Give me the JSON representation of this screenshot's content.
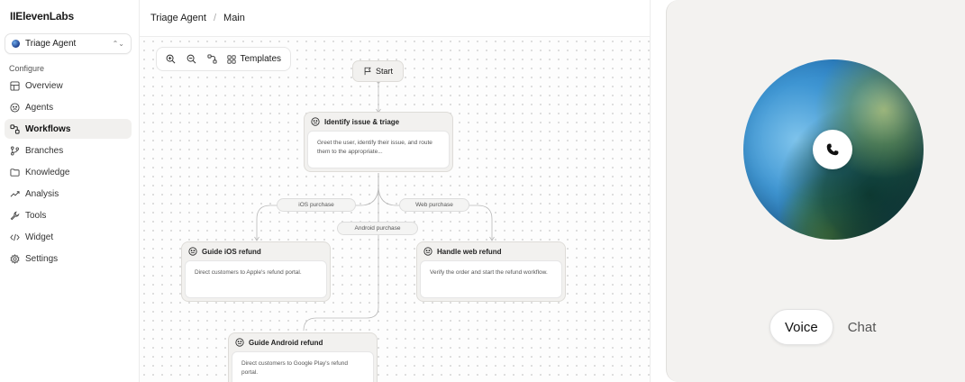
{
  "brand": "IIElevenLabs",
  "agent_selector": {
    "name": "Triage Agent"
  },
  "sidebar": {
    "section_label": "Configure",
    "items": [
      {
        "label": "Overview",
        "icon": "overview-icon",
        "active": false
      },
      {
        "label": "Agents",
        "icon": "agents-icon",
        "active": false
      },
      {
        "label": "Workflows",
        "icon": "workflows-icon",
        "active": true
      },
      {
        "label": "Branches",
        "icon": "branches-icon",
        "active": false
      },
      {
        "label": "Knowledge",
        "icon": "knowledge-icon",
        "active": false
      },
      {
        "label": "Analysis",
        "icon": "analysis-icon",
        "active": false
      },
      {
        "label": "Tools",
        "icon": "tools-icon",
        "active": false
      },
      {
        "label": "Widget",
        "icon": "widget-icon",
        "active": false
      },
      {
        "label": "Settings",
        "icon": "settings-icon",
        "active": false
      }
    ]
  },
  "breadcrumb": {
    "agent": "Triage Agent",
    "separator": "/",
    "branch": "Main"
  },
  "toolbar": {
    "templates_label": "Templates"
  },
  "workflow": {
    "start_label": "Start",
    "nodes": {
      "triage": {
        "title": "Identify issue & triage",
        "body": "Greet the user, identify their issue, and route them to the appropriate..."
      },
      "ios": {
        "title": "Guide iOS refund",
        "body": "Direct customers to Apple's refund portal."
      },
      "web": {
        "title": "Handle web refund",
        "body": "Verify the order and start the refund workflow."
      },
      "android": {
        "title": "Guide Android refund",
        "body": "Direct customers to Google Play's refund portal."
      }
    },
    "edge_labels": {
      "ios": "iOS purchase",
      "web": "Web purchase",
      "android": "Android purchase"
    }
  },
  "preview": {
    "modes": [
      "Voice",
      "Chat"
    ],
    "active_mode": "Voice"
  }
}
